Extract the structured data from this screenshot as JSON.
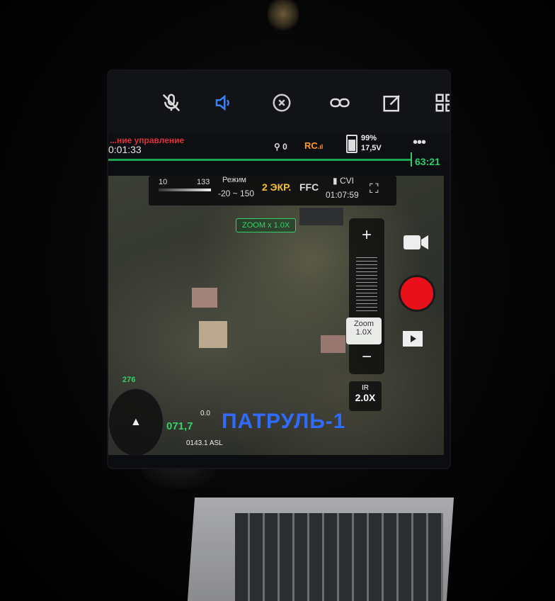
{
  "toolbar": {
    "icons": [
      "mic-off-icon",
      "volume-icon",
      "close-circle-icon",
      "link-icon",
      "edit-icon",
      "grid-icon"
    ]
  },
  "status": {
    "recording_label": "...ние управление",
    "elapsed": "0:01:33",
    "signal": "0",
    "rc": "RC",
    "battery_pct": "99%",
    "battery_volt": "17,5V",
    "remaining": "63:21",
    "progress_fraction": 0.9
  },
  "camera": {
    "range_low": "10",
    "range_high": "133",
    "mode_label": "Режим",
    "mode_range": "-20 ~ 150",
    "screen_mode": "2 ЭКР.",
    "ffc": "FFC",
    "cvi": "CVI",
    "cvi_time": "01:07:59",
    "zoom_hint": "ZOOM x 1.0X",
    "zoom_label": "Zoom",
    "zoom_value": "1.0X",
    "zoom_plus": "+",
    "zoom_minus": "−",
    "ir_label": "IR",
    "ir_value": "2.0X"
  },
  "hud": {
    "patrol_label": "ПАТРУЛЬ-1",
    "altitude": "071,7",
    "asl": "0143.1 ASL",
    "heading": "276",
    "speed": "0.0"
  },
  "colors": {
    "accent_green": "#27d06a",
    "rec_red": "#e8101a",
    "patrol_blue": "#2f6bff",
    "rc_orange": "#ff9a2e"
  }
}
